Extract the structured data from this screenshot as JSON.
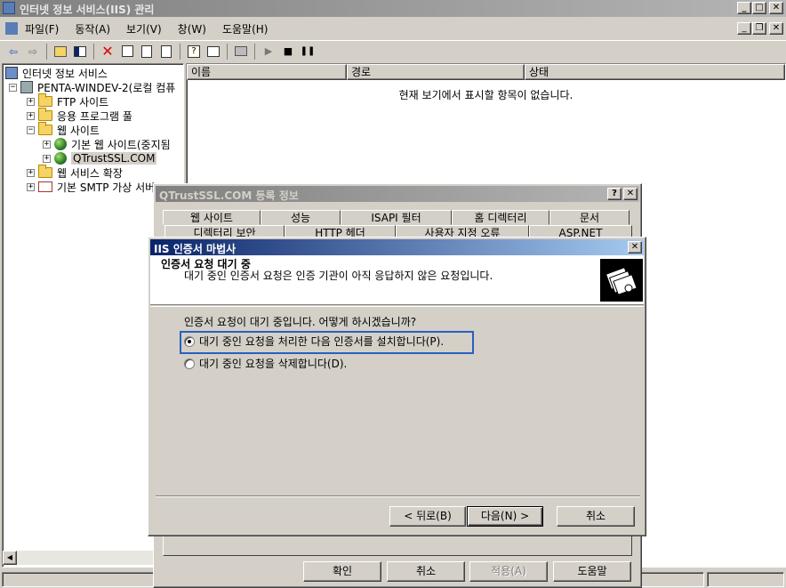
{
  "window": {
    "title": "인터넷 정보 서비스(IIS) 관리"
  },
  "menu": [
    "파일(F)",
    "동작(A)",
    "보기(V)",
    "창(W)",
    "도움말(H)"
  ],
  "tree": {
    "root": "인터넷 정보 서비스",
    "server": "PENTA-WINDEV-2(로컬 컴퓨",
    "ftp": "FTP 사이트",
    "apppool": "응용 프로그램 풀",
    "websites": "웹 사이트",
    "default_site": "기본 웹 사이트(중지됨",
    "qtrust": "QTrustSSL.COM",
    "webext": "웹 서비스 확장",
    "smtp": "기본 SMTP 가상 서버"
  },
  "list": {
    "columns": [
      "이름",
      "경로",
      "상태"
    ],
    "empty_message": "현재 보기에서 표시할 항목이 없습니다."
  },
  "props": {
    "title": "QTrustSSL.COM 등록 정보",
    "tabs_row1": [
      "웹 사이트",
      "성능",
      "ISAPI 필터",
      "홈 디렉터리",
      "문서"
    ],
    "tabs_row2": [
      "디렉터리 보안",
      "HTTP 헤더",
      "사용자 지정 오류",
      "ASP.NET"
    ],
    "buttons": {
      "ok": "확인",
      "cancel": "취소",
      "apply": "적용(A)",
      "help": "도움말"
    }
  },
  "wizard": {
    "title": "IIS 인증서 마법사",
    "heading": "인증서 요청 대기 중",
    "description": "대기 중인 인증서 요청은 인증 기관이 아직 응답하지 않은 요청입니다.",
    "question": "인증서 요청이 대기 중입니다. 어떻게 하시겠습니까?",
    "option_process": "대기 중인 요청을 처리한 다음 인증서를 설치합니다(P).",
    "option_delete": "대기 중인 요청을 삭제합니다(D).",
    "selected": "process",
    "buttons": {
      "back": "< 뒤로(B)",
      "next": "다음(N) >",
      "cancel": "취소"
    }
  }
}
